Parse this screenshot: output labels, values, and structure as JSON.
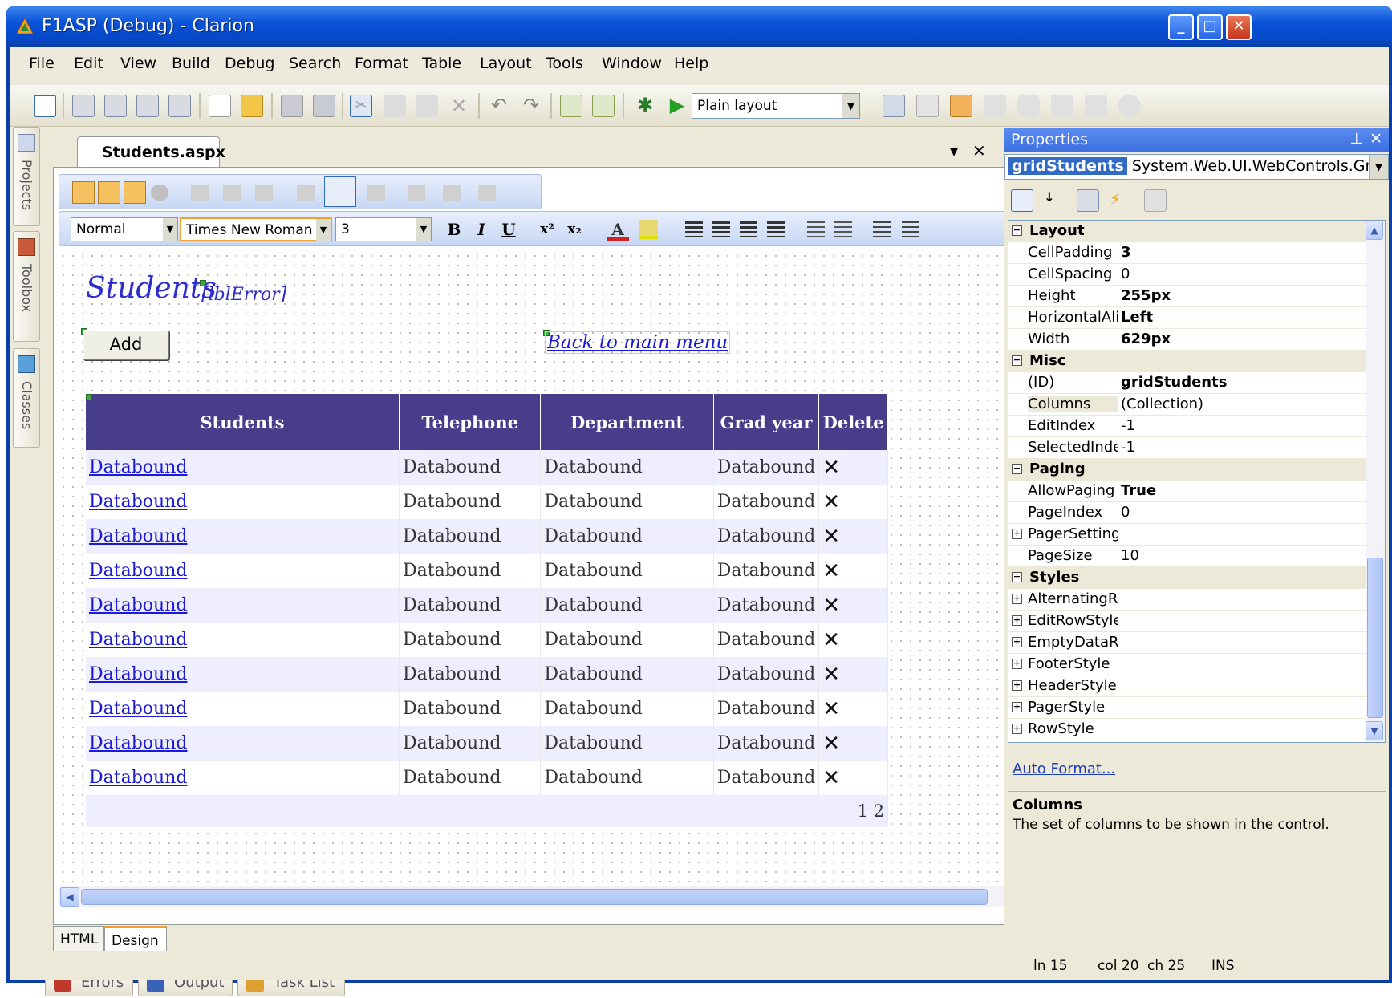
{
  "window": {
    "title": "F1ASP (Debug) - Clarion"
  },
  "menu": [
    "File",
    "Edit",
    "View",
    "Build",
    "Debug",
    "Search",
    "Format",
    "Table",
    "Layout",
    "Tools",
    "Window",
    "Help"
  ],
  "toolbar": {
    "layout_value": "Plain layout"
  },
  "side_tabs": [
    "Projects",
    "Toolbox",
    "Classes"
  ],
  "document": {
    "tab_label": "Students.aspx",
    "format_toolbar": {
      "block_format": "Normal",
      "font_name": "Times New Roman",
      "font_size": "3"
    },
    "page": {
      "title": "Students",
      "error_label": "[lblError]",
      "add_button": "Add",
      "back_link": "Back to main menu",
      "grid": {
        "headers": [
          "Students",
          "Telephone",
          "Department",
          "Grad year",
          "Delete"
        ],
        "rows": [
          [
            "Databound",
            "Databound",
            "Databound",
            "Databound",
            "✕"
          ],
          [
            "Databound",
            "Databound",
            "Databound",
            "Databound",
            "✕"
          ],
          [
            "Databound",
            "Databound",
            "Databound",
            "Databound",
            "✕"
          ],
          [
            "Databound",
            "Databound",
            "Databound",
            "Databound",
            "✕"
          ],
          [
            "Databound",
            "Databound",
            "Databound",
            "Databound",
            "✕"
          ],
          [
            "Databound",
            "Databound",
            "Databound",
            "Databound",
            "✕"
          ],
          [
            "Databound",
            "Databound",
            "Databound",
            "Databound",
            "✕"
          ],
          [
            "Databound",
            "Databound",
            "Databound",
            "Databound",
            "✕"
          ],
          [
            "Databound",
            "Databound",
            "Databound",
            "Databound",
            "✕"
          ],
          [
            "Databound",
            "Databound",
            "Databound",
            "Databound",
            "✕"
          ]
        ],
        "pager": "1 2"
      }
    },
    "view_tabs": [
      "HTML",
      "Design"
    ],
    "active_view_tab": "Design"
  },
  "bottom_tabs": [
    "Errors",
    "Output",
    "Task List"
  ],
  "properties": {
    "title": "Properties",
    "object_name": "gridStudents",
    "object_type": "System.Web.UI.WebControls.GridView",
    "rows": [
      {
        "kind": "category",
        "name": "Layout"
      },
      {
        "kind": "prop",
        "name": "CellPadding",
        "value": "3",
        "bold": true
      },
      {
        "kind": "prop",
        "name": "CellSpacing",
        "value": "0",
        "bold": false
      },
      {
        "kind": "prop",
        "name": "Height",
        "value": "255px",
        "bold": true
      },
      {
        "kind": "prop",
        "name": "HorizontalAlign",
        "value": "Left",
        "bold": true
      },
      {
        "kind": "prop",
        "name": "Width",
        "value": "629px",
        "bold": true
      },
      {
        "kind": "category",
        "name": "Misc"
      },
      {
        "kind": "prop",
        "name": "(ID)",
        "value": "gridStudents",
        "bold": true
      },
      {
        "kind": "prop",
        "name": "Columns",
        "value": "(Collection)",
        "bold": false,
        "selected": true
      },
      {
        "kind": "prop",
        "name": "EditIndex",
        "value": "-1",
        "bold": false
      },
      {
        "kind": "prop",
        "name": "SelectedIndex",
        "value": "-1",
        "bold": false
      },
      {
        "kind": "category",
        "name": "Paging"
      },
      {
        "kind": "prop",
        "name": "AllowPaging",
        "value": "True",
        "bold": true
      },
      {
        "kind": "prop",
        "name": "PageIndex",
        "value": "0",
        "bold": false
      },
      {
        "kind": "expandable",
        "name": "PagerSettings",
        "value": ""
      },
      {
        "kind": "prop",
        "name": "PageSize",
        "value": "10",
        "bold": false
      },
      {
        "kind": "category",
        "name": "Styles"
      },
      {
        "kind": "expandable",
        "name": "AlternatingRowStyle",
        "value": ""
      },
      {
        "kind": "expandable",
        "name": "EditRowStyle",
        "value": ""
      },
      {
        "kind": "expandable",
        "name": "EmptyDataRowStyle",
        "value": ""
      },
      {
        "kind": "expandable",
        "name": "FooterStyle",
        "value": ""
      },
      {
        "kind": "expandable",
        "name": "HeaderStyle",
        "value": ""
      },
      {
        "kind": "expandable",
        "name": "PagerStyle",
        "value": ""
      },
      {
        "kind": "expandable",
        "name": "RowStyle",
        "value": ""
      }
    ],
    "auto_format": "Auto Format...",
    "description_title": "Columns",
    "description_text": "The set of columns to be shown in the control."
  },
  "status": {
    "line": "ln 15",
    "col": "col 20",
    "ch": "ch 25",
    "mode": "INS"
  },
  "colors": {
    "grid_header": "#483d8b",
    "grid_alt_row": "#eeeeff",
    "link": "#1a1ad8",
    "title_bar": "#0a52d8"
  }
}
